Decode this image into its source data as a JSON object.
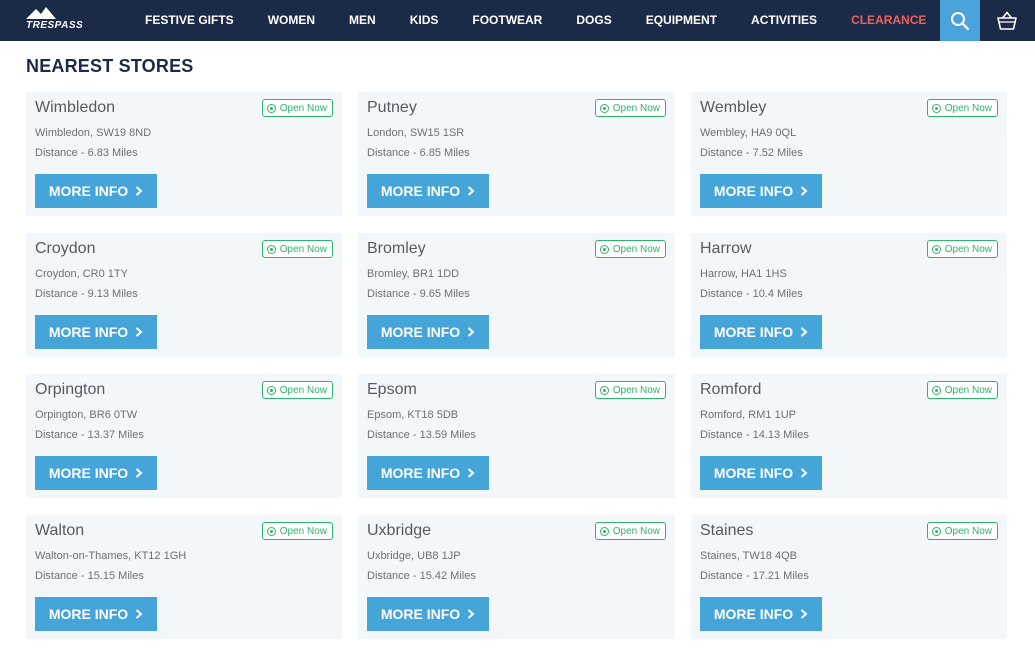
{
  "brand": {
    "logo_text": "TRESPASS"
  },
  "nav": {
    "items": [
      {
        "label": "FESTIVE GIFTS"
      },
      {
        "label": "WOMEN"
      },
      {
        "label": "MEN"
      },
      {
        "label": "KIDS"
      },
      {
        "label": "FOOTWEAR"
      },
      {
        "label": "DOGS"
      },
      {
        "label": "EQUIPMENT"
      },
      {
        "label": "ACTIVITIES"
      },
      {
        "label": "CLEARANCE"
      }
    ],
    "search_icon": "search-icon",
    "basket_icon": "basket-icon"
  },
  "page": {
    "title": "NEAREST STORES"
  },
  "stores": [
    {
      "name": "Wimbledon",
      "status": "Open Now",
      "address": "Wimbledon, SW19 8ND",
      "distance": "Distance - 6.83 Miles",
      "button": "MORE INFO"
    },
    {
      "name": "Putney",
      "status": "Open Now",
      "address": "London, SW15 1SR",
      "distance": "Distance - 6.85 Miles",
      "button": "MORE INFO"
    },
    {
      "name": "Wembley",
      "status": "Open Now",
      "address": "Wembley, HA9 0QL",
      "distance": "Distance - 7.52 Miles",
      "button": "MORE INFO"
    },
    {
      "name": "Croydon",
      "status": "Open Now",
      "address": "Croydon, CR0 1TY",
      "distance": "Distance - 9.13 Miles",
      "button": "MORE INFO"
    },
    {
      "name": "Bromley",
      "status": "Open Now",
      "address": "Bromley, BR1 1DD",
      "distance": "Distance - 9.65 Miles",
      "button": "MORE INFO"
    },
    {
      "name": "Harrow",
      "status": "Open Now",
      "address": "Harrow, HA1 1HS",
      "distance": "Distance - 10.4 Miles",
      "button": "MORE INFO"
    },
    {
      "name": "Orpington",
      "status": "Open Now",
      "address": "Orpington, BR6 0TW",
      "distance": "Distance - 13.37 Miles",
      "button": "MORE INFO"
    },
    {
      "name": "Epsom",
      "status": "Open Now",
      "address": "Epsom, KT18 5DB",
      "distance": "Distance - 13.59 Miles",
      "button": "MORE INFO"
    },
    {
      "name": "Romford",
      "status": "Open Now",
      "address": "Romford, RM1 1UP",
      "distance": "Distance - 14.13 Miles",
      "button": "MORE INFO"
    },
    {
      "name": "Walton",
      "status": "Open Now",
      "address": "Walton-on-Thames, KT12 1GH",
      "distance": "Distance - 15.15 Miles",
      "button": "MORE INFO"
    },
    {
      "name": "Uxbridge",
      "status": "Open Now",
      "address": "Uxbridge, UB8 1JP",
      "distance": "Distance - 15.42 Miles",
      "button": "MORE INFO"
    },
    {
      "name": "Staines",
      "status": "Open Now",
      "address": "Staines, TW18 4QB",
      "distance": "Distance - 17.21 Miles",
      "button": "MORE INFO"
    }
  ],
  "colors": {
    "nav_bg": "#1b2a47",
    "accent": "#45a5d9",
    "clearance": "#f0615c",
    "open_green": "#2fb36b",
    "card_bg": "#f3f7fa"
  }
}
